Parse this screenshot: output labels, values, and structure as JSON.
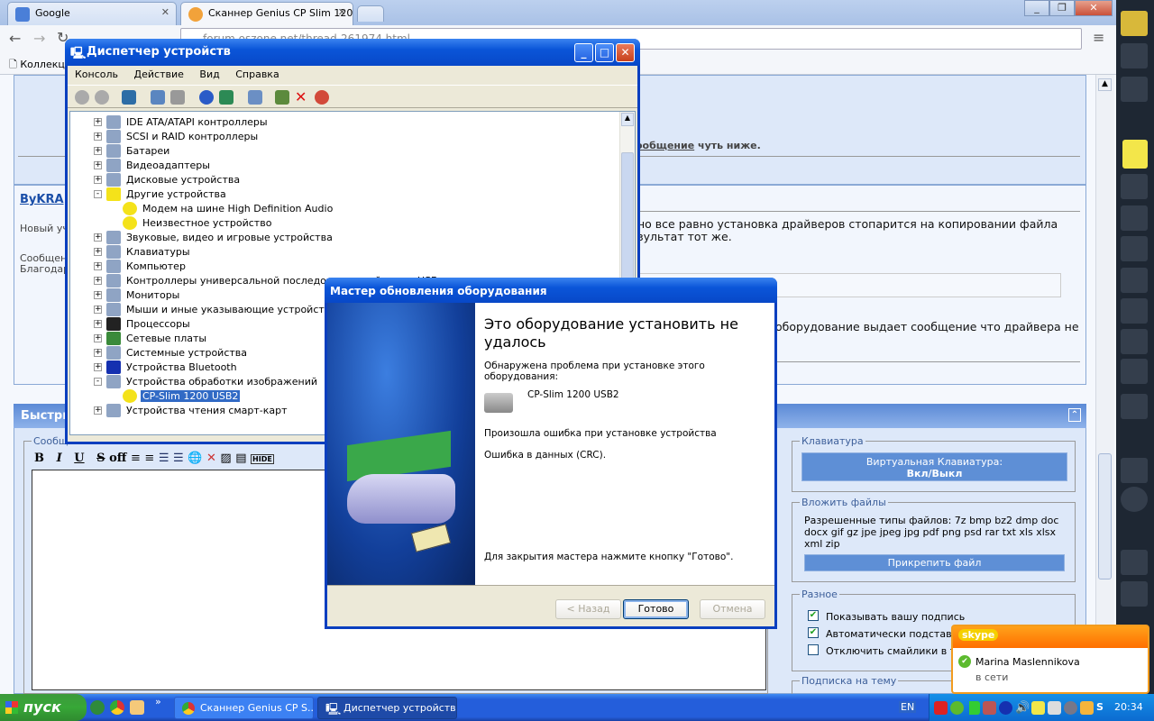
{
  "browser": {
    "tabs": [
      {
        "label": "Google",
        "active": false
      },
      {
        "label": "Сканнер Genius CP Slim 120(",
        "active": true
      }
    ],
    "address": "forum.oszone.net/thread-261974.html",
    "bookmark": "Коллекц"
  },
  "forum": {
    "author": "ByKRA",
    "user_title": "Новый уч",
    "msg_label": "Сообщен",
    "thanks_label": "Благодар",
    "notice_link": "ообщение",
    "notice_rest": " чуть ниже.",
    "post_line1": "но все равно установка драйверов стопарится на копировании файла",
    "post_line2": "зультат тот же.",
    "post_line3": "оборудование выдает сообщение что драйвера не",
    "quick_reply_title": "Быстрь",
    "message_legend": "Сообщение",
    "editor_buttons": [
      "B",
      "I",
      "U",
      "S",
      "off",
      "HIDE"
    ],
    "keyboard": {
      "legend": "Клавиатура",
      "button_line1": "Виртуальная Клавиатура:",
      "button_line2": "Вкл/Выкл"
    },
    "attach": {
      "legend": "Вложить файлы",
      "text": "Разрешенные типы файлов: 7z bmp bz2 dmp doc docx gif gz jpe jpeg jpg pdf png psd rar txt xls xlsx xml zip",
      "button": "Прикрепить файл"
    },
    "misc": {
      "legend": "Разное",
      "options": [
        {
          "label": "Показывать вашу подпись",
          "checked": true
        },
        {
          "label": "Автоматически подставлять",
          "checked": true
        },
        {
          "label": "Отключить смайлики в тексте",
          "checked": false
        }
      ]
    },
    "subscribe_legend": "Подписка на тему"
  },
  "device_manager": {
    "title": "Диспетчер устройств",
    "menu": [
      "Консоль",
      "Действие",
      "Вид",
      "Справка"
    ],
    "tree": [
      {
        "label": "IDE ATA/ATAPI контроллеры",
        "level": 0,
        "expander": "+",
        "icon": "ide-icon"
      },
      {
        "label": "SCSI и RAID контроллеры",
        "level": 0,
        "expander": "+",
        "icon": "scsi-icon"
      },
      {
        "label": "Батареи",
        "level": 0,
        "expander": "+",
        "icon": "battery-icon"
      },
      {
        "label": "Видеоадаптеры",
        "level": 0,
        "expander": "+",
        "icon": "display-icon"
      },
      {
        "label": "Дисковые устройства",
        "level": 0,
        "expander": "+",
        "icon": "disk-icon"
      },
      {
        "label": "Другие устройства",
        "level": 0,
        "expander": "-",
        "icon": "unknown-device-icon"
      },
      {
        "label": "Модем на шине High Definition Audio",
        "level": 1,
        "expander": "",
        "icon": "warning-icon"
      },
      {
        "label": "Неизвестное устройство",
        "level": 1,
        "expander": "",
        "icon": "warning-icon"
      },
      {
        "label": "Звуковые, видео и игровые устройства",
        "level": 0,
        "expander": "+",
        "icon": "sound-icon"
      },
      {
        "label": "Клавиатуры",
        "level": 0,
        "expander": "+",
        "icon": "keyboard-icon"
      },
      {
        "label": "Компьютер",
        "level": 0,
        "expander": "+",
        "icon": "computer-icon"
      },
      {
        "label": "Контроллеры универсальной последовательной шины USB",
        "level": 0,
        "expander": "+",
        "icon": "usb-icon"
      },
      {
        "label": "Мониторы",
        "level": 0,
        "expander": "+",
        "icon": "monitor-icon"
      },
      {
        "label": "Мыши и иные указывающие устройства",
        "level": 0,
        "expander": "+",
        "icon": "mouse-icon"
      },
      {
        "label": "Процессоры",
        "level": 0,
        "expander": "+",
        "icon": "cpu-icon"
      },
      {
        "label": "Сетевые платы",
        "level": 0,
        "expander": "+",
        "icon": "network-icon"
      },
      {
        "label": "Системные устройства",
        "level": 0,
        "expander": "+",
        "icon": "system-icon"
      },
      {
        "label": "Устройства Bluetooth",
        "level": 0,
        "expander": "+",
        "icon": "bluetooth-icon"
      },
      {
        "label": "Устройства обработки изображений",
        "level": 0,
        "expander": "-",
        "icon": "imaging-icon"
      },
      {
        "label": "CP-Slim 1200 USB2",
        "level": 1,
        "expander": "",
        "icon": "warning-icon",
        "selected": true
      },
      {
        "label": "Устройства чтения смарт-карт",
        "level": 0,
        "expander": "+",
        "icon": "smartcard-icon"
      }
    ]
  },
  "wizard": {
    "title": "Мастер обновления оборудования",
    "heading": "Это оборудование установить не удалось",
    "problem": "Обнаружена проблема при установке этого оборудования:",
    "device": "CP-Slim 1200 USB2",
    "error1": "Произошла ошибка при установке устройства",
    "error2": "Ошибка в данных (CRC).",
    "close_hint": "Для закрытия мастера нажмите кнопку \"Готово\".",
    "back": "< Назад",
    "finish": "Готово",
    "cancel": "Отмена"
  },
  "skype": {
    "logo": "skype",
    "contact": "Marina Maslennikova",
    "status": "в сети"
  },
  "taskbar": {
    "start": "пуск",
    "tasks": [
      {
        "label": "Сканнер Genius CP S...",
        "active": false
      },
      {
        "label": "Диспетчер устройств",
        "active": true
      }
    ],
    "lang": "EN",
    "clock": "20:34"
  }
}
